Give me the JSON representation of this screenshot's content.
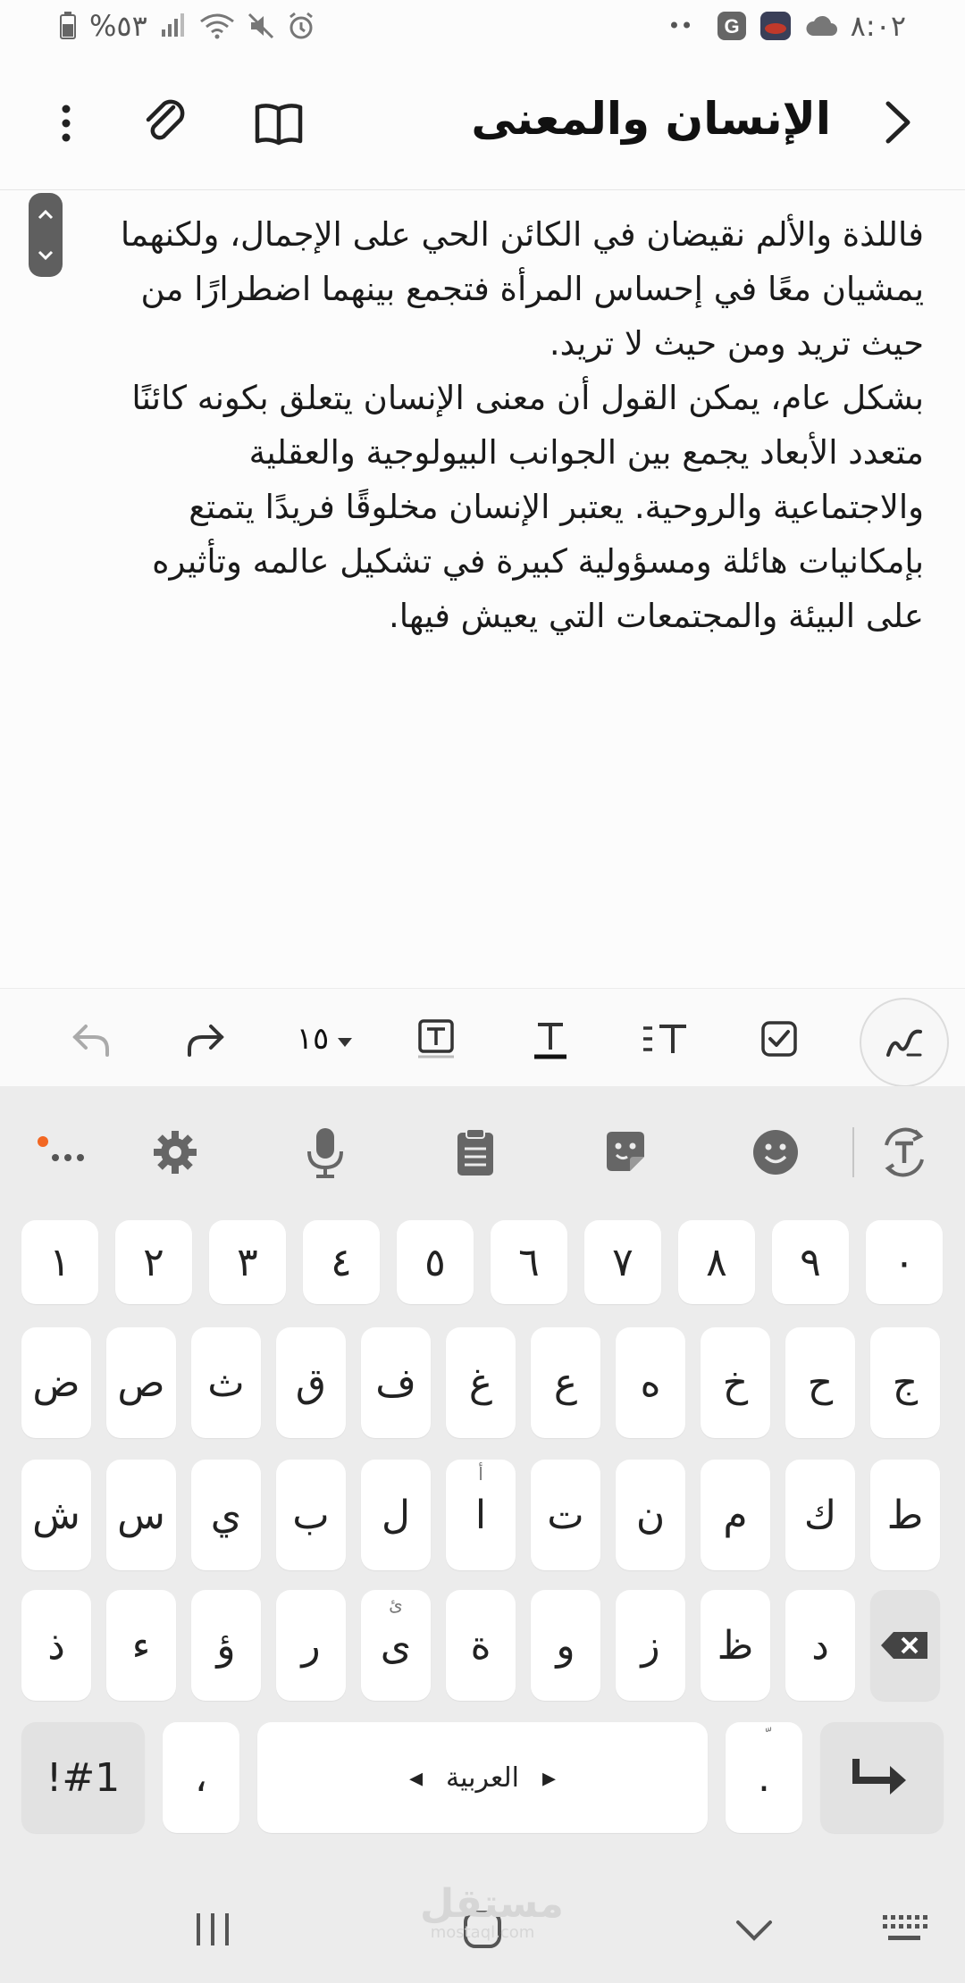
{
  "status_bar": {
    "battery": "%٥٣",
    "time": "٨:٠٢",
    "dots": "••"
  },
  "header": {
    "title": "الإنسان والمعنى",
    "back_icon": "chevron-right-icon",
    "icons": [
      "reader-mode-icon",
      "attach-icon",
      "more-vert-icon"
    ]
  },
  "note": {
    "text": "فاللذة والألم نقيضان في الكائن الحي على الإجمال، ولكنهما يمشيان معًا في إحساس المرأة فتجمع بينهما اضطرارًا من حيث تريد ومن حيث لا تريد.\nبشكل عام، يمكن القول أن معنى الإنسان يتعلق بكونه كائنًا متعدد الأبعاد يجمع بين الجوانب البيولوجية والعقلية والاجتماعية والروحية. يعتبر الإنسان مخلوقًا فريدًا يتمتع بإمكانيات هائلة ومسؤولية كبيرة في تشكيل عالمه وتأثيره على البيئة والمجتمعات التي يعيش فيها."
  },
  "format_toolbar": {
    "font_size": "١٥",
    "tools": [
      "undo-icon",
      "redo-icon",
      "font-size-dropdown",
      "text-box-icon",
      "text-style-icon",
      "paragraph-icon",
      "checkbox-icon",
      "handwriting-icon"
    ]
  },
  "keyboard": {
    "tool_row": [
      "more-icon",
      "settings-icon",
      "mic-icon",
      "clipboard-icon",
      "sticker-icon",
      "emoji-icon",
      "translate-icon"
    ],
    "number_row": [
      "١",
      "٢",
      "٣",
      "٤",
      "٥",
      "٦",
      "٧",
      "٨",
      "٩",
      "٠"
    ],
    "row1": [
      "ض",
      "ص",
      "ث",
      "ق",
      "ف",
      "غ",
      "ع",
      "ه",
      "خ",
      "ح",
      "ج"
    ],
    "row2": [
      "ش",
      "س",
      "ي",
      "ب",
      "ل",
      "ا",
      "ت",
      "ن",
      "م",
      "ك",
      "ط"
    ],
    "row2_hints": [
      "",
      "",
      "",
      "",
      "",
      "أ",
      "",
      "",
      "",
      "",
      ""
    ],
    "row3": [
      "ذ",
      "ء",
      "ؤ",
      "ر",
      "ى",
      "ة",
      "و",
      "ز",
      "ظ",
      "د"
    ],
    "row3_hints": [
      "",
      "",
      "",
      "",
      "ئ",
      "",
      "",
      "",
      "",
      ""
    ],
    "symbols_key": "!#1",
    "comma_key": "،",
    "space_label": "العربية",
    "period_key": ".",
    "period_hint": "ّ"
  },
  "nav_bar": {
    "buttons": [
      "recents-icon",
      "home-icon",
      "back-down-icon",
      "keyboard-icon"
    ]
  },
  "watermark": {
    "text": "مستقل",
    "sub": "mostaql.com"
  }
}
